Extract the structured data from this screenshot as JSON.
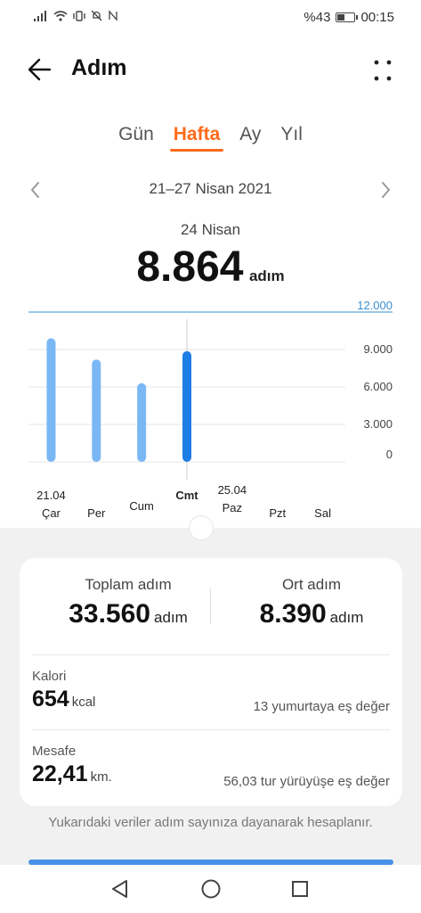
{
  "status_bar": {
    "battery": "%43",
    "time": "00:15"
  },
  "header": {
    "title": "Adım"
  },
  "tabs": [
    {
      "label": "Gün",
      "active": false
    },
    {
      "label": "Hafta",
      "active": true
    },
    {
      "label": "Ay",
      "active": false
    },
    {
      "label": "Yıl",
      "active": false
    }
  ],
  "date_range": "21–27 Nisan 2021",
  "selected": {
    "date": "24 Nisan",
    "steps": "8.864",
    "unit": "adım"
  },
  "chart_data": {
    "type": "bar",
    "categories": [
      "Çar",
      "Per",
      "Cum",
      "Cmt",
      "Paz",
      "Pzt",
      "Sal"
    ],
    "date_labels": [
      "21.04",
      "",
      "",
      "",
      "25.04",
      "",
      ""
    ],
    "values": [
      9900,
      8200,
      6300,
      8864,
      0,
      0,
      0
    ],
    "selected_index": 3,
    "ylim": [
      0,
      12000
    ],
    "y_ticks": [
      "12.000",
      "9.000",
      "6.000",
      "3.000",
      "0"
    ],
    "bar_color": "#7ab8f5",
    "selected_color": "#1f7de6",
    "goal_line_color": "#3a8fd0"
  },
  "summary": {
    "total_label": "Toplam adım",
    "total_value": "33.560",
    "total_unit": "adım",
    "avg_label": "Ort adım",
    "avg_value": "8.390",
    "avg_unit": "adım"
  },
  "calories": {
    "label": "Kalori",
    "value": "654",
    "unit": "kcal",
    "note": "13 yumurtaya eş değer"
  },
  "distance": {
    "label": "Mesafe",
    "value": "22,41",
    "unit": "km.",
    "note": "56,03 tur yürüyüşe eş değer"
  },
  "footnote": "Yukarıdaki veriler adım sayınıza dayanarak hesaplanır.",
  "colors": {
    "accent": "#ff6a1a",
    "chart_blue": "#1f7de6"
  }
}
